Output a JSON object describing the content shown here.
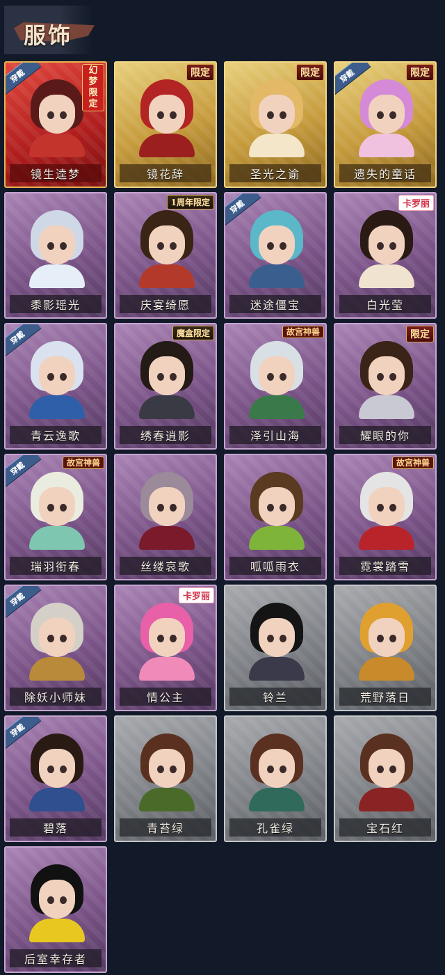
{
  "header": {
    "title": "服饰"
  },
  "equipped_label": "穿戴",
  "badges": {
    "limited": "限定",
    "anniversary": "1周年限定",
    "mohe": "魔盒限定",
    "gugong": "故宫神兽",
    "kaluoli": "卡罗丽",
    "huanmeng": "幻梦限定"
  },
  "colors": {
    "background": "#121a29",
    "red_rarity": "#b01e1e",
    "gold_rarity": "#c69b3d",
    "purple_rarity": "#7b5488",
    "grey_rarity": "#7e8186",
    "equip_ribbon": "#3c5d8c"
  },
  "costumes": [
    {
      "name": "镜生逵梦",
      "rarity": "red",
      "equipped": true,
      "badge": "huanmeng",
      "hair": "#5a1a1a",
      "outfit": "#c2342c"
    },
    {
      "name": "镜花辞",
      "rarity": "gold",
      "equipped": false,
      "badge": "limited",
      "hair": "#b32424",
      "outfit": "#9c1f1f"
    },
    {
      "name": "圣光之谕",
      "rarity": "gold",
      "equipped": false,
      "badge": "limited",
      "hair": "#e3b867",
      "outfit": "#f4e6c8"
    },
    {
      "name": "遗失的童话",
      "rarity": "gold",
      "equipped": true,
      "badge": "limited",
      "hair": "#d58ad8",
      "outfit": "#f1c2e0"
    },
    {
      "name": "黍影瑶光",
      "rarity": "purple",
      "equipped": false,
      "badge": "",
      "hair": "#cfd8e6",
      "outfit": "#e6eef8"
    },
    {
      "name": "庆宴绮愿",
      "rarity": "purple",
      "equipped": false,
      "badge": "anniversary",
      "hair": "#3a2416",
      "outfit": "#b33a2a"
    },
    {
      "name": "迷途僵宝",
      "rarity": "purple",
      "equipped": true,
      "badge": "",
      "hair": "#5ab8c9",
      "outfit": "#3a5f8f"
    },
    {
      "name": "白光莹",
      "rarity": "purple",
      "equipped": false,
      "badge": "kaluoli",
      "hair": "#2a1a14",
      "outfit": "#f0e4d0"
    },
    {
      "name": "青云逸歌",
      "rarity": "purple",
      "equipped": true,
      "badge": "",
      "hair": "#d9e2ee",
      "outfit": "#2f5fa8"
    },
    {
      "name": "绣春逍影",
      "rarity": "purple",
      "equipped": false,
      "badge": "mohe",
      "hair": "#241a16",
      "outfit": "#3a3a44"
    },
    {
      "name": "泽引山海",
      "rarity": "purple",
      "equipped": false,
      "badge": "gugong",
      "hair": "#d8e0e6",
      "outfit": "#3a7a4a"
    },
    {
      "name": "耀眼的你",
      "rarity": "purple",
      "equipped": false,
      "badge": "limited",
      "hair": "#3a2418",
      "outfit": "#c9c9d4"
    },
    {
      "name": "瑞羽衔春",
      "rarity": "purple",
      "equipped": true,
      "badge": "gugong",
      "hair": "#e9ecdf",
      "outfit": "#7ec6b0"
    },
    {
      "name": "丝缕哀歌",
      "rarity": "purple",
      "equipped": false,
      "badge": "",
      "hair": "#9a8a9a",
      "outfit": "#7a1a2a"
    },
    {
      "name": "呱呱雨衣",
      "rarity": "purple",
      "equipped": false,
      "badge": "",
      "hair": "#5a3a20",
      "outfit": "#7fb43a"
    },
    {
      "name": "霓裳踏雪",
      "rarity": "purple",
      "equipped": false,
      "badge": "gugong",
      "hair": "#e4e4e4",
      "outfit": "#b8242a"
    },
    {
      "name": "除妖小师妹",
      "rarity": "purple",
      "equipped": true,
      "badge": "",
      "hair": "#d4d0c8",
      "outfit": "#b88a3a"
    },
    {
      "name": "情公主",
      "rarity": "purple",
      "equipped": false,
      "badge": "kaluoli",
      "hair": "#e860a8",
      "outfit": "#f08ab8"
    },
    {
      "name": "铃兰",
      "rarity": "grey",
      "equipped": false,
      "badge": "",
      "hair": "#141414",
      "outfit": "#3a3a4a"
    },
    {
      "name": "荒野落日",
      "rarity": "grey",
      "equipped": false,
      "badge": "",
      "hair": "#e0a030",
      "outfit": "#c88a2a"
    },
    {
      "name": "碧落",
      "rarity": "purple",
      "equipped": true,
      "badge": "",
      "hair": "#2a1a14",
      "outfit": "#2f4f8f"
    },
    {
      "name": "青苔绿",
      "rarity": "grey",
      "equipped": false,
      "badge": "",
      "hair": "#5a3020",
      "outfit": "#4a6a2a"
    },
    {
      "name": "孔雀绿",
      "rarity": "grey",
      "equipped": false,
      "badge": "",
      "hair": "#5a3020",
      "outfit": "#2f6a5a"
    },
    {
      "name": "宝石红",
      "rarity": "grey",
      "equipped": false,
      "badge": "",
      "hair": "#5a3020",
      "outfit": "#8a2424"
    },
    {
      "name": "后室幸存者",
      "rarity": "purple",
      "equipped": false,
      "badge": "",
      "hair": "#111111",
      "outfit": "#e8c820"
    }
  ]
}
